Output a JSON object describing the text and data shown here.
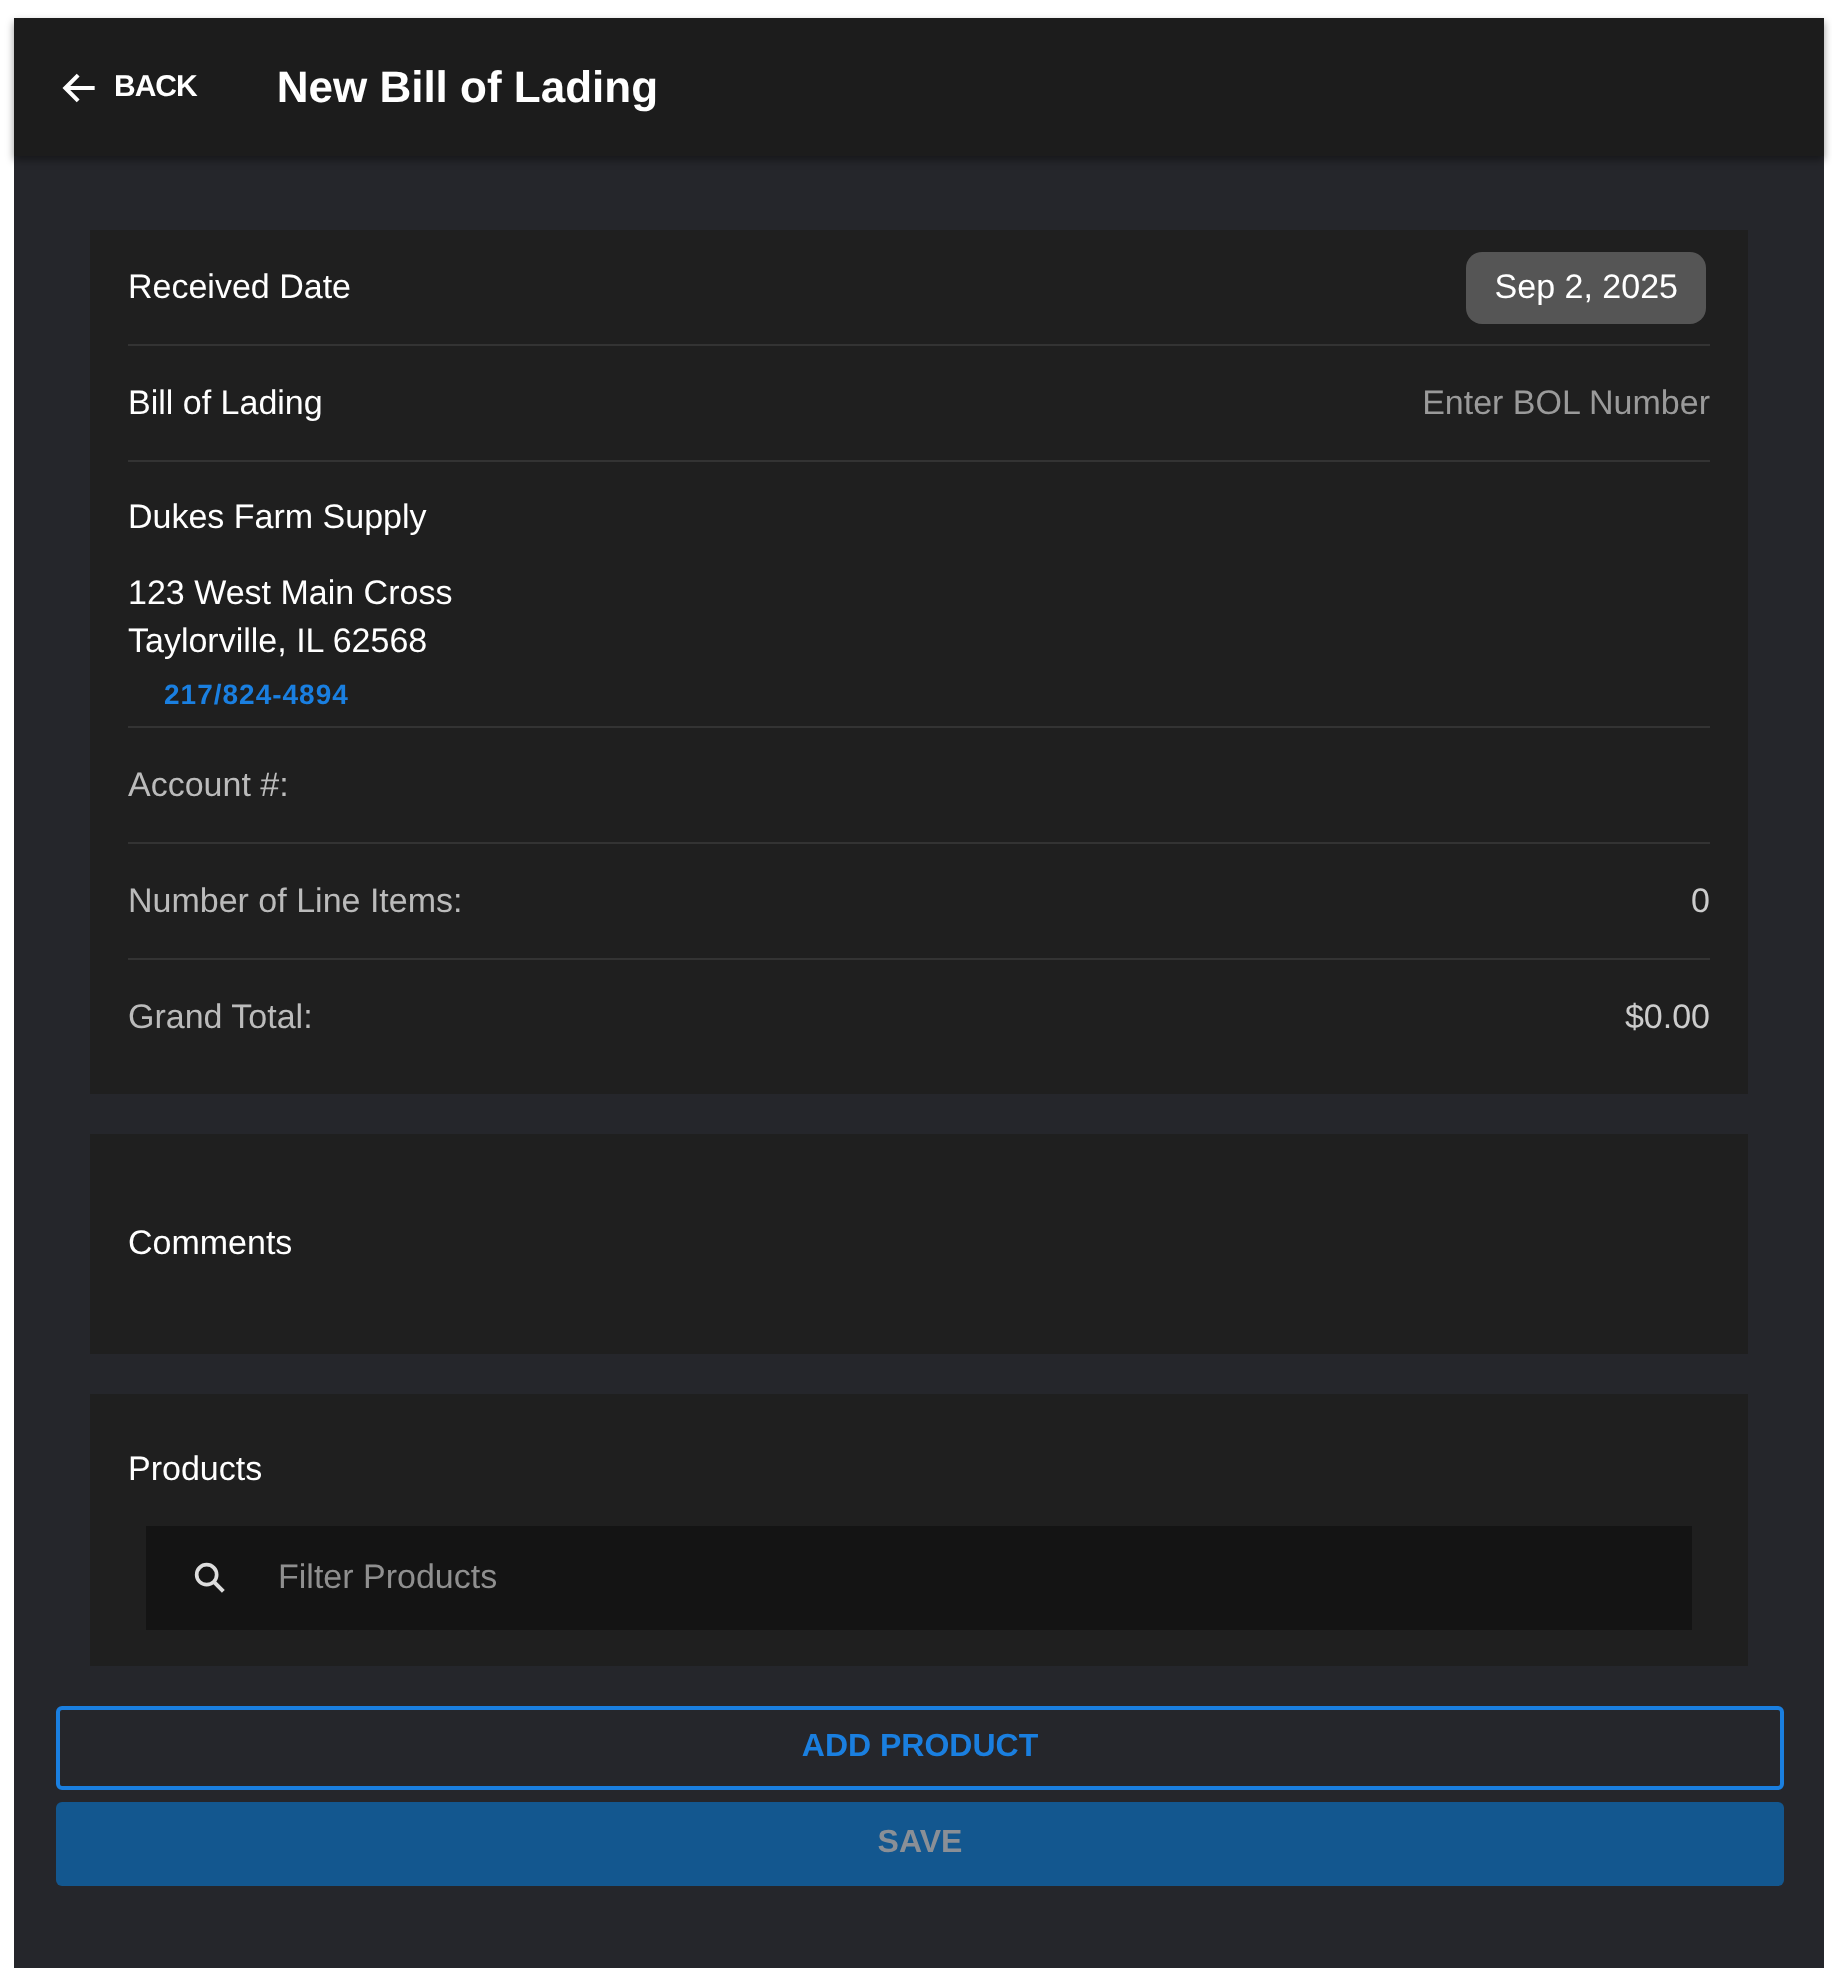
{
  "header": {
    "back_label": "BACK",
    "title": "New Bill of Lading"
  },
  "details": {
    "received_date": {
      "label": "Received Date",
      "value": "Sep 2, 2025"
    },
    "bill_of_lading": {
      "label": "Bill of Lading",
      "placeholder": "Enter BOL Number"
    },
    "vendor": {
      "name": "Dukes Farm Supply",
      "address_lines": [
        "123 West Main Cross",
        "Taylorville, IL 62568"
      ],
      "phone": "217/824-4894"
    },
    "summary": [
      {
        "label": "Account #:"
      },
      {
        "label": "Number of Line Items:",
        "value": "0"
      },
      {
        "label": "Grand Total:",
        "value": "$0.00"
      }
    ]
  },
  "comments": {
    "title": "Comments"
  },
  "products": {
    "title": "Products",
    "filter_placeholder": "Filter Products"
  },
  "buttons": [
    {
      "kind": "outline",
      "label": "ADD PRODUCT",
      "disabled": false
    },
    {
      "kind": "filled",
      "label": "SAVE",
      "disabled": true
    }
  ]
}
